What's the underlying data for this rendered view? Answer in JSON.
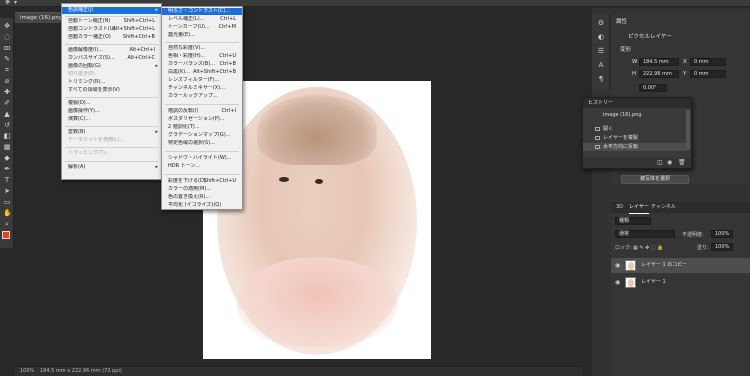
{
  "window": {
    "doc_tab": "image (16).png"
  },
  "menu1": {
    "items": [
      {
        "label": "色調補正(J)",
        "shortcut": "",
        "submenu": true,
        "state": "highlighted"
      },
      {
        "label": "自動トーン補正(N)",
        "shortcut": "Shift+Ctrl+L"
      },
      {
        "label": "自動コントラスト(U)",
        "shortcut": "Alt+Shift+Ctrl+L"
      },
      {
        "label": "自動カラー補正(O)",
        "shortcut": "Shift+Ctrl+B"
      },
      {
        "label": "画像解像度(I)...",
        "shortcut": "Alt+Ctrl+I"
      },
      {
        "label": "カンバスサイズ(S)...",
        "shortcut": "Alt+Ctrl+C"
      },
      {
        "label": "画像の回転(G)",
        "shortcut": "",
        "submenu": true
      },
      {
        "label": "切り抜き(P)",
        "shortcut": "",
        "state": "disabled"
      },
      {
        "label": "トリミング(R)...",
        "shortcut": ""
      },
      {
        "label": "すべての領域を表示(V)",
        "shortcut": ""
      },
      {
        "label": "複製(D)...",
        "shortcut": ""
      },
      {
        "label": "画像操作(Y)...",
        "shortcut": ""
      },
      {
        "label": "演算(C)...",
        "shortcut": ""
      },
      {
        "label": "変数(B)",
        "shortcut": "",
        "submenu": true
      },
      {
        "label": "データセットを適用(L)...",
        "shortcut": "",
        "state": "disabled"
      },
      {
        "label": "トラッピング(T)...",
        "shortcut": "",
        "state": "disabled"
      },
      {
        "label": "解析(A)",
        "shortcut": "",
        "submenu": true
      }
    ]
  },
  "menu2": {
    "items": [
      {
        "label": "明るさ・コントラスト(C)...",
        "shortcut": "",
        "state": "highlighted"
      },
      {
        "label": "レベル補正(L)...",
        "shortcut": "Ctrl+L"
      },
      {
        "label": "トーンカーブ(U)...",
        "shortcut": "Ctrl+M"
      },
      {
        "label": "露光量(E)...",
        "shortcut": ""
      },
      {
        "label": "自然な彩度(V)...",
        "shortcut": ""
      },
      {
        "label": "色相・彩度(H)...",
        "shortcut": "Ctrl+U"
      },
      {
        "label": "カラーバランス(B)...",
        "shortcut": "Ctrl+B"
      },
      {
        "label": "白黒(K)...",
        "shortcut": "Alt+Shift+Ctrl+B"
      },
      {
        "label": "レンズフィルター(F)...",
        "shortcut": ""
      },
      {
        "label": "チャンネルミキサー(X)...",
        "shortcut": ""
      },
      {
        "label": "カラールックアップ...",
        "shortcut": ""
      },
      {
        "label": "階調の反転(I)",
        "shortcut": "Ctrl+I"
      },
      {
        "label": "ポスタリゼーション(P)...",
        "shortcut": ""
      },
      {
        "label": "2 階調化(T)...",
        "shortcut": ""
      },
      {
        "label": "グラデーションマップ(G)...",
        "shortcut": ""
      },
      {
        "label": "特定色域の選択(S)...",
        "shortcut": ""
      },
      {
        "label": "シャドウ・ハイライト(W)...",
        "shortcut": ""
      },
      {
        "label": "HDR トーン...",
        "shortcut": ""
      },
      {
        "label": "彩度を下げる(D)",
        "shortcut": "Shift+Ctrl+U"
      },
      {
        "label": "カラーの適用(M)...",
        "shortcut": ""
      },
      {
        "label": "色の置き換え(R)...",
        "shortcut": ""
      },
      {
        "label": "平均化 (イコライズ)(Q)",
        "shortcut": ""
      }
    ]
  },
  "properties": {
    "title": "属性",
    "layer_type": "ピクセルレイヤー",
    "transform_label": "変形",
    "w_label": "W",
    "w_value": "184.5 mm",
    "h_label": "H",
    "h_value": "222.96 mm",
    "x_label": "X",
    "x_value": "0 mm",
    "y_label": "Y",
    "y_value": "0 mm",
    "angle_value": "0.00°",
    "select_button": "被写体を選択"
  },
  "history": {
    "title": "ヒストリー",
    "snapshot": "image (16).png",
    "items": [
      {
        "label": "開く"
      },
      {
        "label": "レイヤーを複製"
      },
      {
        "label": "水平方向に反転",
        "selected": true
      }
    ]
  },
  "layers": {
    "tab_3d": "3D",
    "tab_layers": "レイヤー",
    "tab_channels": "チャンネル",
    "filter_kind": "種類",
    "blend_mode": "通常",
    "opacity_label": "不透明度:",
    "opacity_value": "100%",
    "lock_label": "ロック:",
    "fill_label": "塗り:",
    "fill_value": "100%",
    "rows": [
      {
        "name": "レイヤー 1 のコピー",
        "selected": true
      },
      {
        "name": "レイヤー 1",
        "selected": false
      }
    ]
  },
  "status": {
    "zoom": "100%",
    "doc_size": "184.5 mm x 222.96 mm (72 ppi)"
  },
  "colors": {
    "foreground": "#e8421f",
    "background": "#ffffff",
    "menu_highlight": "#1e6fd9"
  }
}
